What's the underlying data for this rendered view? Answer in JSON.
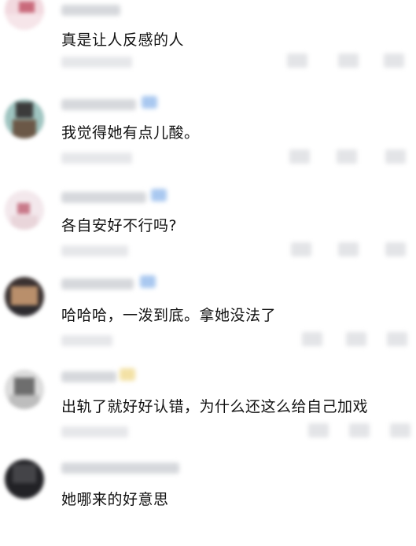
{
  "comments": [
    {
      "text": "真是让人反感的人"
    },
    {
      "text": "我觉得她有点儿酸。"
    },
    {
      "text": "各自安好不行吗?"
    },
    {
      "text": "哈哈哈，一泼到底。拿她没法了"
    },
    {
      "text": "出轨了就好好认错，为什么还这么给自己加戏"
    },
    {
      "text": "她哪来的好意思"
    }
  ],
  "colors": {
    "text": "#111111",
    "blur_gray": "#d6d8dc",
    "badge_blue": "#a9c8f0",
    "badge_yellow": "#f3e1a5"
  }
}
